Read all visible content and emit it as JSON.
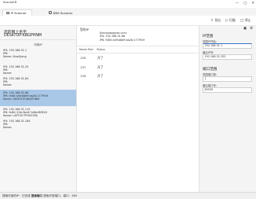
{
  "app": {
    "title": "ScannerR",
    "controls": {
      "minimize": "—",
      "maximize": "▢",
      "close": "✕"
    }
  },
  "tabs": [
    {
      "label": "IP Scanner",
      "active": true
    },
    {
      "label": "DNS Scanner",
      "active": false
    }
  ],
  "toolbar": {
    "export_label": "导出",
    "scan_label": "扫描",
    "stop_label": "停止"
  },
  "left": {
    "pc_label": "您的网上名字",
    "pc_name": "DESKTOP-KBGPHNM",
    "list_title": "可用IP",
    "hosts": [
      {
        "ip": "IP4: 192.168.31.1",
        "ip6": "IP6:",
        "name": "Name: XiaoQiang"
      },
      {
        "ip": "IP4: 192.168.31.20",
        "ip6": "IP6:",
        "name": "Name:"
      },
      {
        "ip": "IP4: 192.168.31.84",
        "ip6": "IP6:",
        "name": "Name:"
      },
      {
        "ip": "IP4: 192.168.31.86",
        "ip6": "IP6: fe80::b6f:b8d9:ba2b:1779%9",
        "name": "Name: DESKTOP-KBGPHNM"
      },
      {
        "ip": "IP4: 192.168.31.115",
        "ip6": "IP6: fe80::20b:3bc8:7a8b:f6f8%9",
        "name": "Name: LAPTOP-PF9H3784"
      },
      {
        "ip": "IP4: 192.168.31.164",
        "ip6": "IP6:",
        "name": "Name:"
      }
    ]
  },
  "main": {
    "local_label": "您的IP",
    "adapter": "Беспроводная сеть",
    "ip4": "IP4: 192.168.31.86",
    "ip6": "IP6: fe80::b6f:b8d9:ba2b:1779%9",
    "col_port": "Name Port",
    "col_status": "Status",
    "ports": [
      {
        "port": "135",
        "status": "开了"
      },
      {
        "port": "137",
        "status": "开了"
      },
      {
        "port": "139",
        "status": "开了"
      }
    ]
  },
  "right": {
    "ip_section": "IP范围",
    "start_label": "范围IP开始:",
    "start_value": "192.168.31.1",
    "end_label": "最后IP号:",
    "end_value": "192.168.31.255",
    "port_section": "端口范围",
    "port_start_label": "范围端口首:",
    "port_start_value": "1",
    "port_end_label": "最后端口号:",
    "port_end_value": "65535"
  },
  "status": {
    "prefix": "搜索可用的IP：已完成",
    "port_scan": "搜索端口",
    "suffix": "搜索开放端口，端口：363"
  }
}
